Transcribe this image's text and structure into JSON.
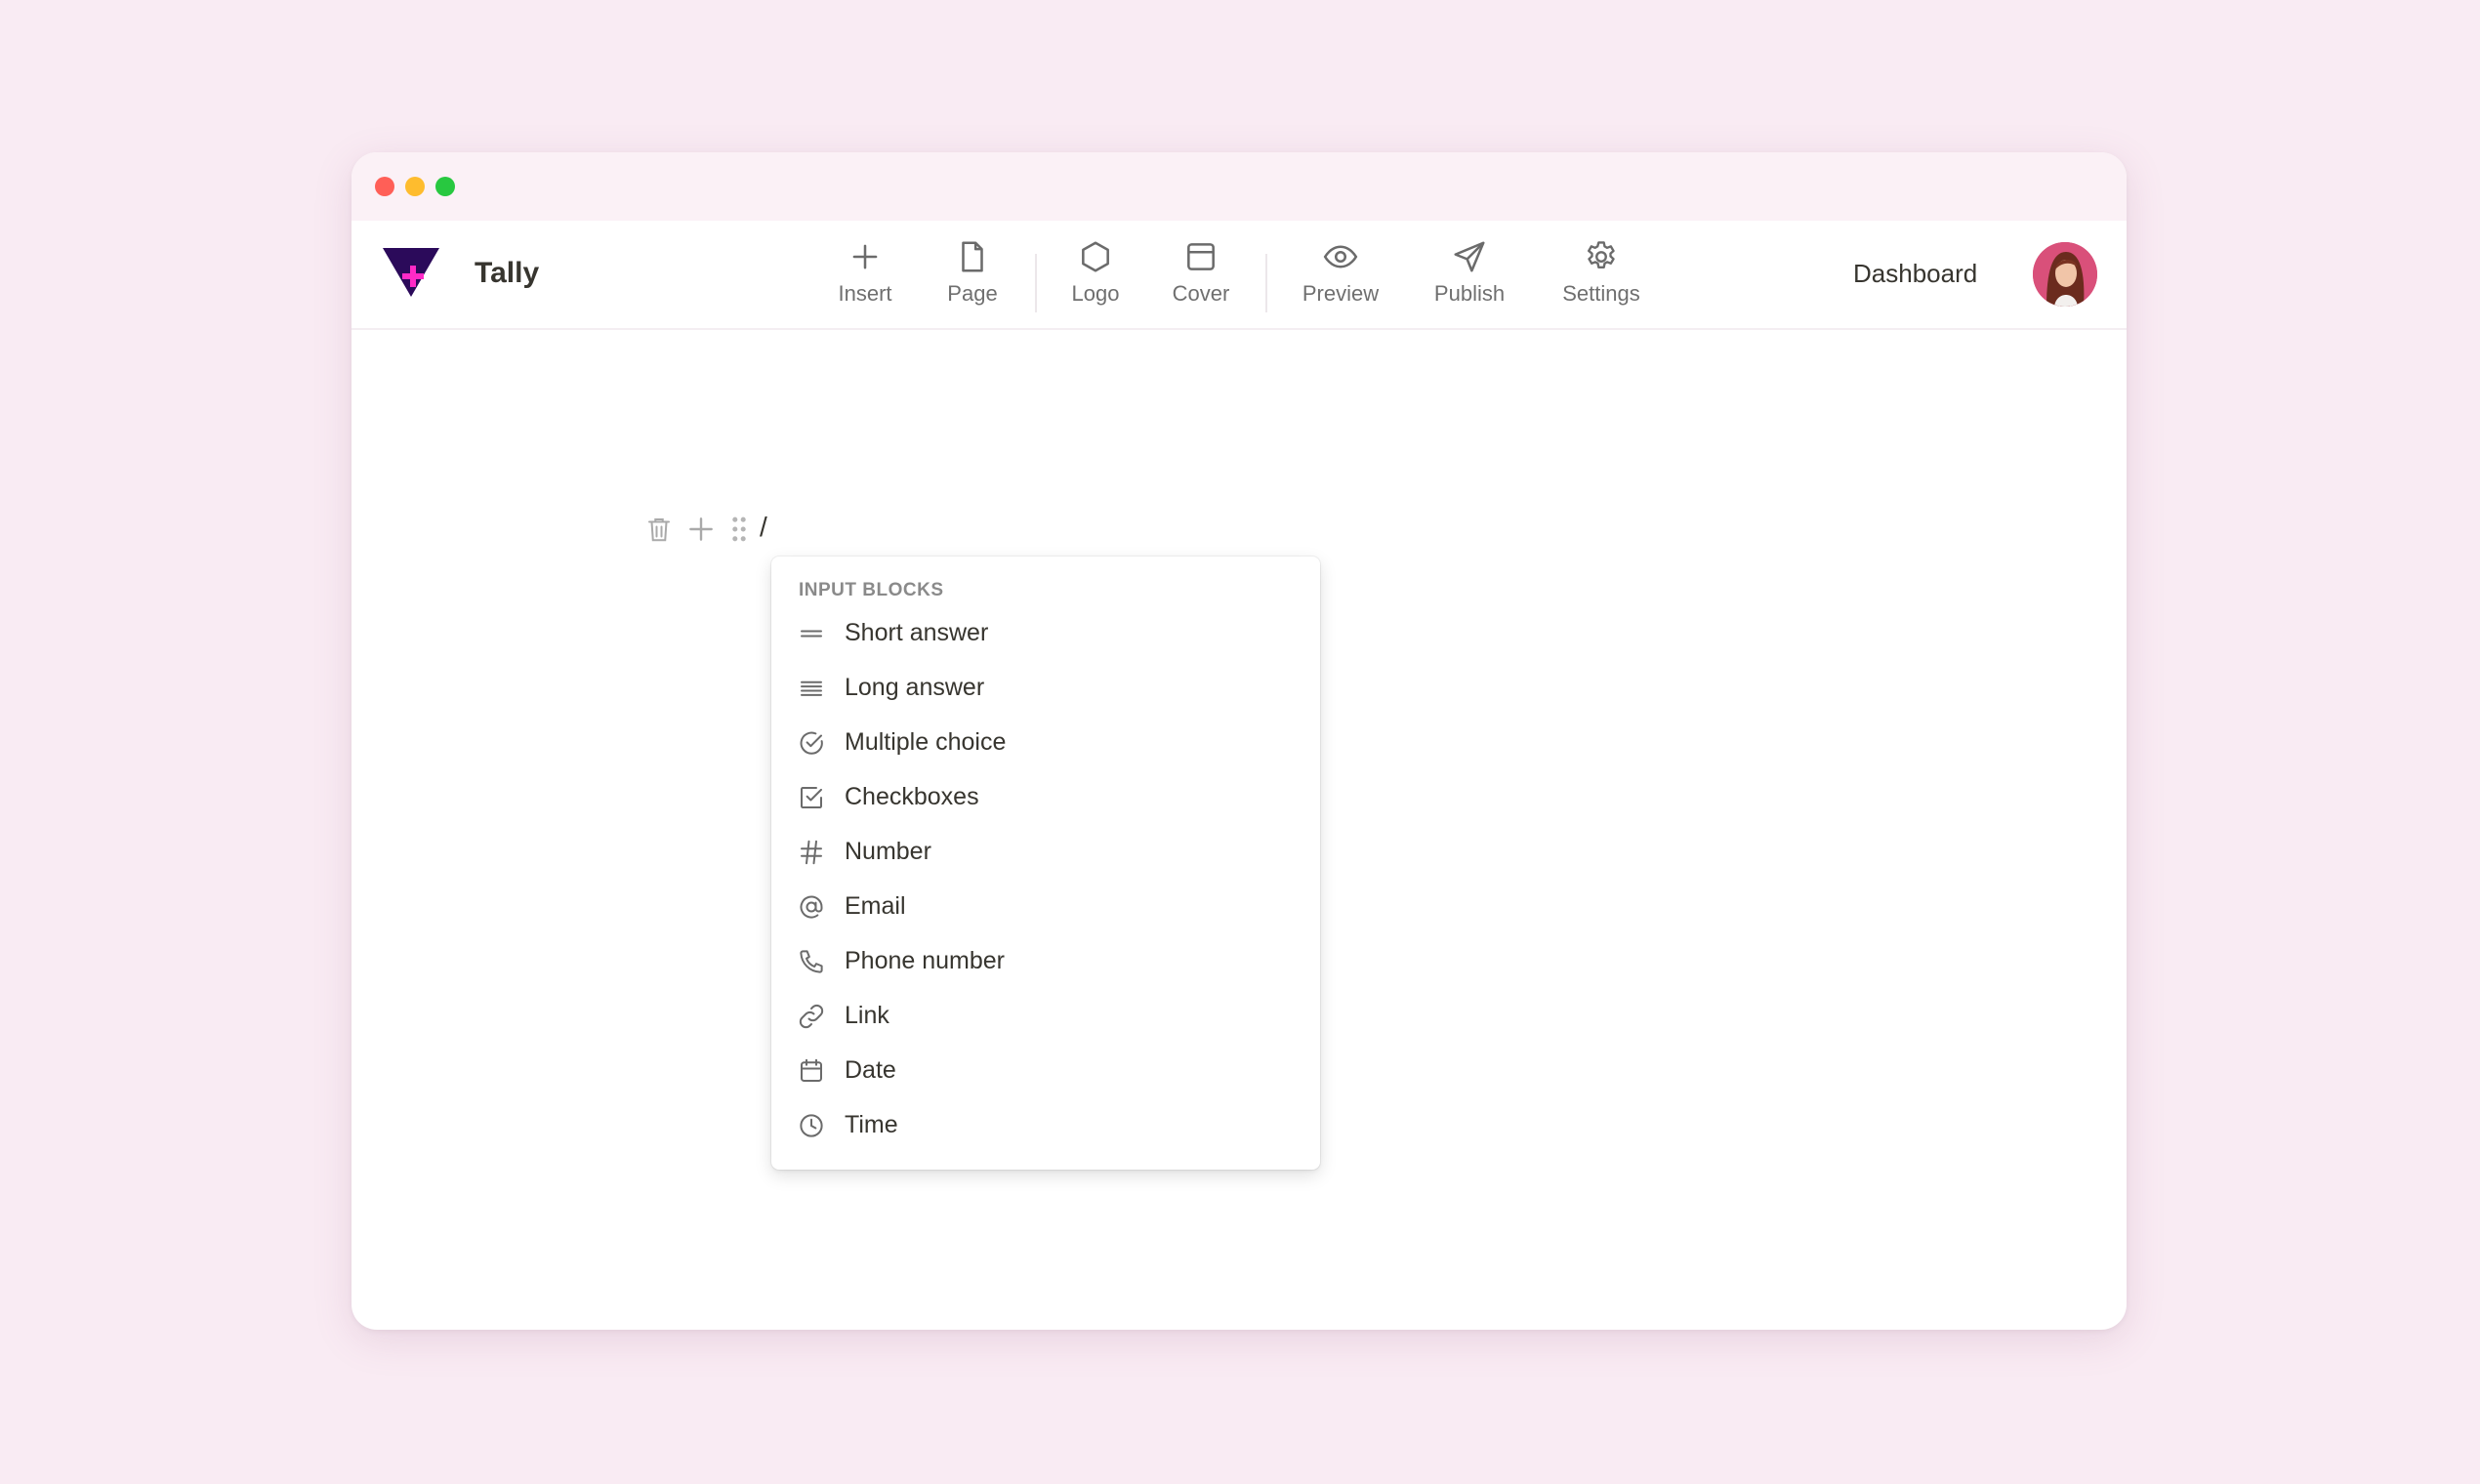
{
  "app": {
    "name": "Tally"
  },
  "window_controls": {
    "close_color": "#ff5f57",
    "minimize_color": "#febc2e",
    "maximize_color": "#28c840"
  },
  "toolbar": {
    "items": [
      {
        "id": "insert",
        "label": "Insert",
        "icon": "plus-icon"
      },
      {
        "id": "page",
        "label": "Page",
        "icon": "page-icon"
      },
      {
        "id": "logo",
        "label": "Logo",
        "icon": "hexagon-icon"
      },
      {
        "id": "cover",
        "label": "Cover",
        "icon": "cover-icon"
      },
      {
        "id": "preview",
        "label": "Preview",
        "icon": "eye-icon"
      },
      {
        "id": "publish",
        "label": "Publish",
        "icon": "send-icon"
      },
      {
        "id": "settings",
        "label": "Settings",
        "icon": "gear-icon"
      }
    ]
  },
  "header": {
    "dashboard_label": "Dashboard",
    "avatar": "user-avatar"
  },
  "editor": {
    "block_tools": [
      "trash-icon",
      "plus-icon",
      "drag-handle-icon"
    ],
    "current_text": "/"
  },
  "menu": {
    "section_title": "INPUT BLOCKS",
    "items": [
      {
        "label": "Short answer",
        "icon": "short-answer-icon"
      },
      {
        "label": "Long answer",
        "icon": "long-answer-icon"
      },
      {
        "label": "Multiple choice",
        "icon": "circle-check-icon"
      },
      {
        "label": "Checkboxes",
        "icon": "checkbox-icon"
      },
      {
        "label": "Number",
        "icon": "hash-icon"
      },
      {
        "label": "Email",
        "icon": "at-icon"
      },
      {
        "label": "Phone number",
        "icon": "phone-icon"
      },
      {
        "label": "Link",
        "icon": "link-icon"
      },
      {
        "label": "Date",
        "icon": "calendar-icon"
      },
      {
        "label": "Time",
        "icon": "clock-icon"
      }
    ]
  },
  "colors": {
    "background": "#f9ebf3",
    "brand_purple": "#2b0a5a",
    "brand_pink": "#ff2ac7",
    "text": "#37352f",
    "muted": "#6f6f6f"
  }
}
